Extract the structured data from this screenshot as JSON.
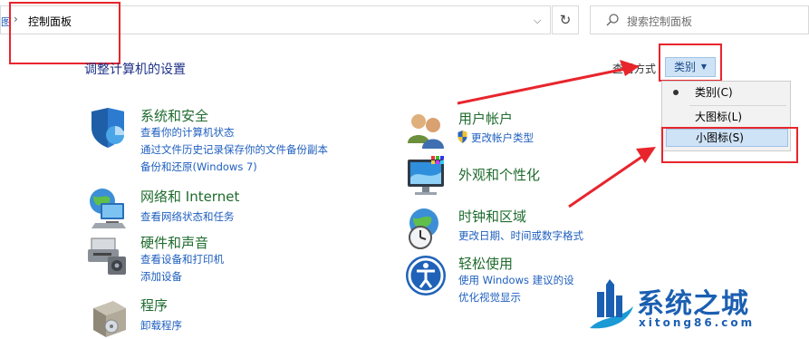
{
  "address_bar": {
    "crumb_left_tip": "图",
    "separator": "›",
    "breadcrumb": "控制面板",
    "dropdown_glyph": "⌵",
    "refresh_glyph": "↻"
  },
  "search": {
    "placeholder": "搜索控制面板"
  },
  "page_title": "调整计算机的设置",
  "view_by": {
    "label": "查看方式",
    "current": "类别",
    "options": [
      "类别(C)",
      "大图标(L)",
      "小图标(S)"
    ]
  },
  "categories": [
    {
      "title": "系统和安全",
      "links": [
        "查看你的计算机状态",
        "通过文件历史记录保存你的文件备份副本",
        "备份和还原(Windows 7)"
      ]
    },
    {
      "title": "网络和 Internet",
      "links": [
        "查看网络状态和任务"
      ]
    },
    {
      "title": "硬件和声音",
      "links": [
        "查看设备和打印机",
        "添加设备"
      ]
    },
    {
      "title": "程序",
      "links": [
        "卸载程序"
      ]
    },
    {
      "title": "用户帐户",
      "links": [
        "更改帐户类型"
      ]
    },
    {
      "title": "外观和个性化",
      "links": []
    },
    {
      "title": "时钟和区域",
      "links": [
        "更改日期、时间或数字格式"
      ]
    },
    {
      "title": "轻松使用",
      "links": [
        "使用 Windows 建议的设",
        "优化视觉显示"
      ]
    }
  ],
  "watermark": {
    "name": "系统之城",
    "url": "xitong86.com"
  },
  "colors": {
    "annotation_red": "#e8252c",
    "link_blue": "#1f5fbf",
    "category_green": "#1f6b2e",
    "title_blue": "#1e3287",
    "selection_blue": "#cfe3f7"
  }
}
